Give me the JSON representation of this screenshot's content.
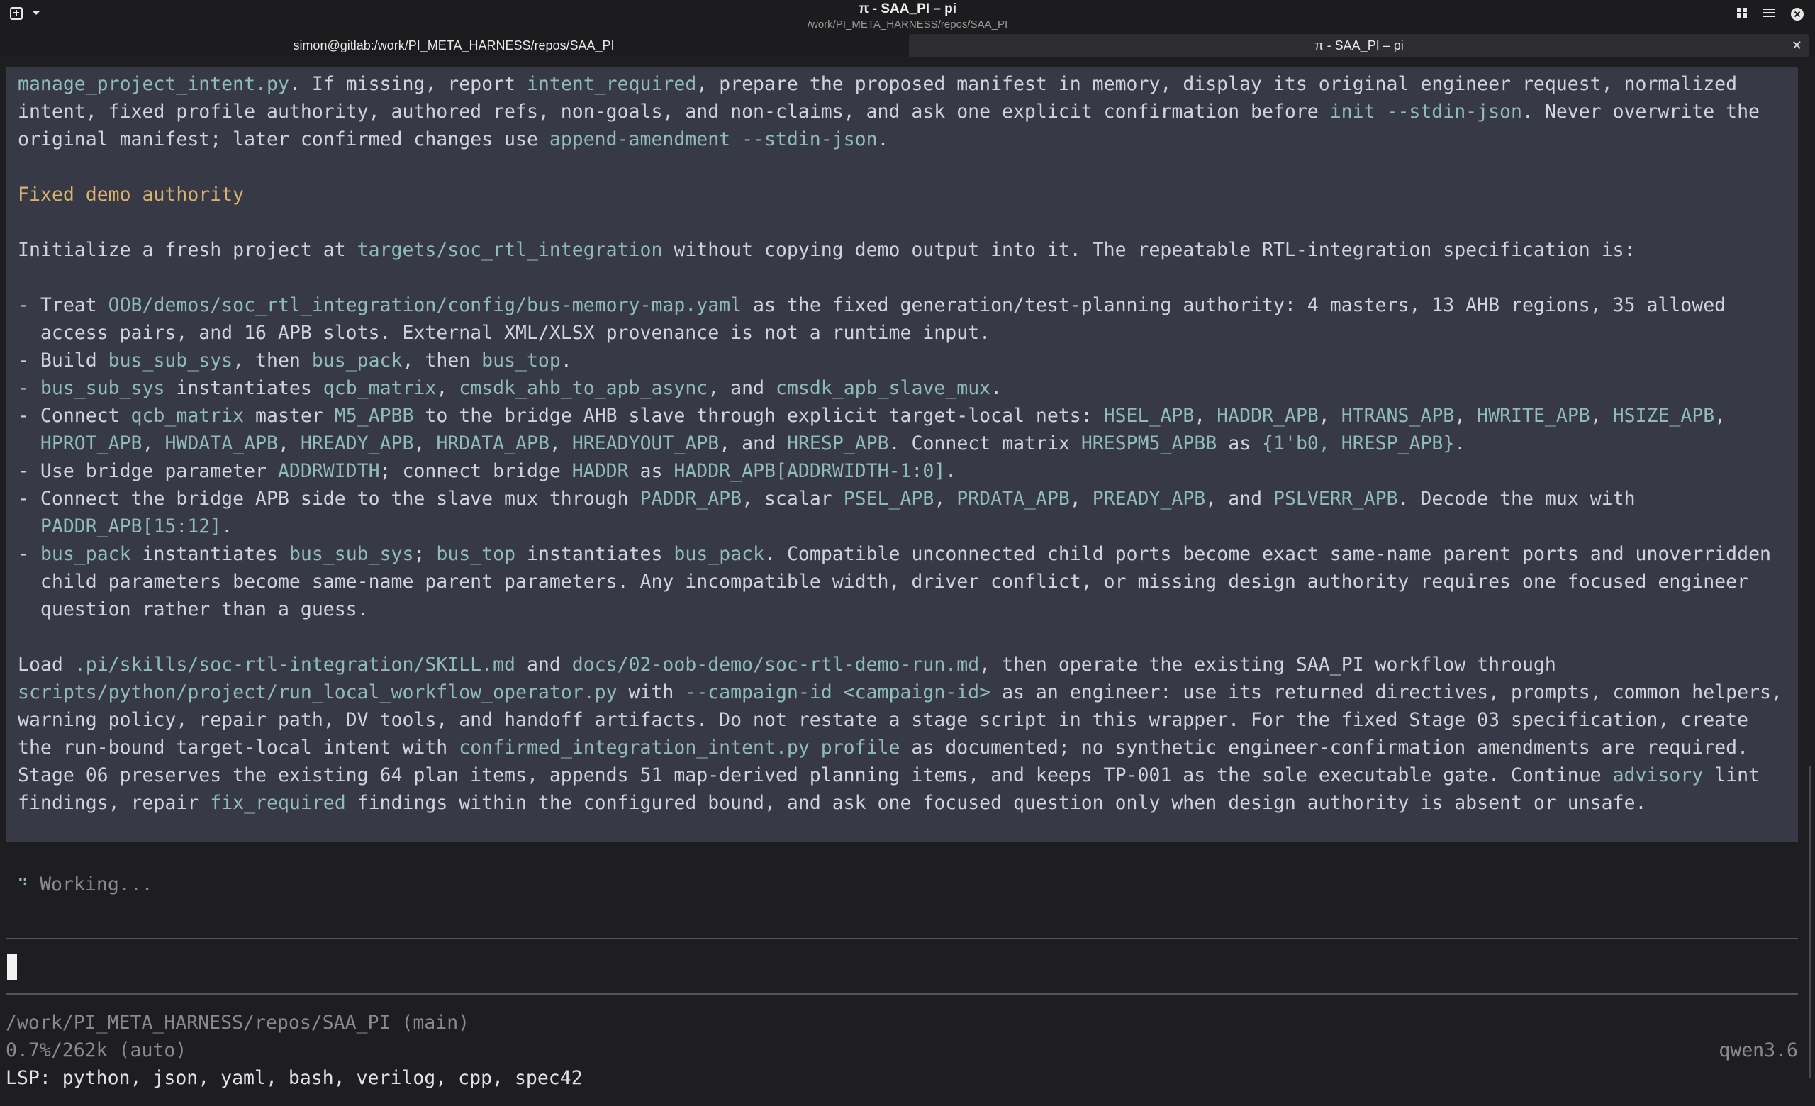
{
  "window": {
    "title": "π - SAA_PI – pi",
    "subtitle": "/work/PI_META_HARNESS/repos/SAA_PI",
    "icons": [
      "window-menu-icon",
      "dropdown-icon",
      "grid-icon",
      "hamburger-menu-icon",
      "close-icon"
    ]
  },
  "tabs": [
    {
      "label": "simon@gitlab:/work/PI_META_HARNESS/repos/SAA_PI",
      "active": false
    },
    {
      "label": "π - SAA_PI – pi",
      "active": true
    }
  ],
  "message": {
    "lines": [
      [
        {
          "t": "manage_project_intent.py",
          "s": "c"
        },
        {
          "t": ". If missing, report "
        },
        {
          "t": "intent_required",
          "s": "c"
        },
        {
          "t": ", prepare the proposed manifest in memory, display its original engineer request, normalized"
        }
      ],
      [
        {
          "t": "intent, fixed profile authority, authored refs, non-goals, and non-claims, and ask one explicit confirmation before "
        },
        {
          "t": "init --stdin-json",
          "s": "c"
        },
        {
          "t": ". Never overwrite the"
        }
      ],
      [
        {
          "t": "original manifest; later confirmed changes use "
        },
        {
          "t": "append-amendment --stdin-json",
          "s": "c"
        },
        {
          "t": "."
        }
      ],
      [],
      [
        {
          "t": "Fixed demo authority",
          "s": "h"
        }
      ],
      [],
      [
        {
          "t": "Initialize a fresh project at "
        },
        {
          "t": "targets/soc_rtl_integration",
          "s": "c"
        },
        {
          "t": " without copying demo output into it. The repeatable RTL-integration specification is:"
        }
      ],
      [],
      [
        {
          "t": "- Treat "
        },
        {
          "t": "OOB/demos/soc_rtl_integration/config/bus-memory-map.yaml",
          "s": "c"
        },
        {
          "t": " as the fixed generation/test-planning authority: 4 masters, 13 AHB regions, 35 allowed"
        }
      ],
      [
        {
          "t": "  access pairs, and 16 APB slots. External XML/XLSX provenance is not a runtime input."
        }
      ],
      [
        {
          "t": "- Build "
        },
        {
          "t": "bus_sub_sys",
          "s": "c"
        },
        {
          "t": ", then "
        },
        {
          "t": "bus_pack",
          "s": "c"
        },
        {
          "t": ", then "
        },
        {
          "t": "bus_top",
          "s": "c"
        },
        {
          "t": "."
        }
      ],
      [
        {
          "t": "- "
        },
        {
          "t": "bus_sub_sys",
          "s": "c"
        },
        {
          "t": " instantiates "
        },
        {
          "t": "qcb_matrix",
          "s": "c"
        },
        {
          "t": ", "
        },
        {
          "t": "cmsdk_ahb_to_apb_async",
          "s": "c"
        },
        {
          "t": ", and "
        },
        {
          "t": "cmsdk_apb_slave_mux",
          "s": "c"
        },
        {
          "t": "."
        }
      ],
      [
        {
          "t": "- Connect "
        },
        {
          "t": "qcb_matrix",
          "s": "c"
        },
        {
          "t": " master "
        },
        {
          "t": "M5_APBB",
          "s": "c"
        },
        {
          "t": " to the bridge AHB slave through explicit target-local nets: "
        },
        {
          "t": "HSEL_APB",
          "s": "c"
        },
        {
          "t": ", "
        },
        {
          "t": "HADDR_APB",
          "s": "c"
        },
        {
          "t": ", "
        },
        {
          "t": "HTRANS_APB",
          "s": "c"
        },
        {
          "t": ", "
        },
        {
          "t": "HWRITE_APB",
          "s": "c"
        },
        {
          "t": ", "
        },
        {
          "t": "HSIZE_APB",
          "s": "c"
        },
        {
          "t": ","
        }
      ],
      [
        {
          "t": "  "
        },
        {
          "t": "HPROT_APB",
          "s": "c"
        },
        {
          "t": ", "
        },
        {
          "t": "HWDATA_APB",
          "s": "c"
        },
        {
          "t": ", "
        },
        {
          "t": "HREADY_APB",
          "s": "c"
        },
        {
          "t": ", "
        },
        {
          "t": "HRDATA_APB",
          "s": "c"
        },
        {
          "t": ", "
        },
        {
          "t": "HREADYOUT_APB",
          "s": "c"
        },
        {
          "t": ", and "
        },
        {
          "t": "HRESP_APB",
          "s": "c"
        },
        {
          "t": ". Connect matrix "
        },
        {
          "t": "HRESPM5_APBB",
          "s": "c"
        },
        {
          "t": " as "
        },
        {
          "t": "{1'b0, HRESP_APB}",
          "s": "c"
        },
        {
          "t": "."
        }
      ],
      [
        {
          "t": "- Use bridge parameter "
        },
        {
          "t": "ADDRWIDTH",
          "s": "c"
        },
        {
          "t": "; connect bridge "
        },
        {
          "t": "HADDR",
          "s": "c"
        },
        {
          "t": " as "
        },
        {
          "t": "HADDR_APB[ADDRWIDTH-1:0]",
          "s": "c"
        },
        {
          "t": "."
        }
      ],
      [
        {
          "t": "- Connect the bridge APB side to the slave mux through "
        },
        {
          "t": "PADDR_APB",
          "s": "c"
        },
        {
          "t": ", scalar "
        },
        {
          "t": "PSEL_APB",
          "s": "c"
        },
        {
          "t": ", "
        },
        {
          "t": "PRDATA_APB",
          "s": "c"
        },
        {
          "t": ", "
        },
        {
          "t": "PREADY_APB",
          "s": "c"
        },
        {
          "t": ", and "
        },
        {
          "t": "PSLVERR_APB",
          "s": "c"
        },
        {
          "t": ". Decode the mux with"
        }
      ],
      [
        {
          "t": "  "
        },
        {
          "t": "PADDR_APB[15:12]",
          "s": "c"
        },
        {
          "t": "."
        }
      ],
      [
        {
          "t": "- "
        },
        {
          "t": "bus_pack",
          "s": "c"
        },
        {
          "t": " instantiates "
        },
        {
          "t": "bus_sub_sys",
          "s": "c"
        },
        {
          "t": "; "
        },
        {
          "t": "bus_top",
          "s": "c"
        },
        {
          "t": " instantiates "
        },
        {
          "t": "bus_pack",
          "s": "c"
        },
        {
          "t": ". Compatible unconnected child ports become exact same-name parent ports and unoverridden"
        }
      ],
      [
        {
          "t": "  child parameters become same-name parent parameters. Any incompatible width, driver conflict, or missing design authority requires one focused engineer"
        }
      ],
      [
        {
          "t": "  question rather than a guess."
        }
      ],
      [],
      [
        {
          "t": "Load "
        },
        {
          "t": ".pi/skills/soc-rtl-integration/SKILL.md",
          "s": "c"
        },
        {
          "t": " and "
        },
        {
          "t": "docs/02-oob-demo/soc-rtl-demo-run.md",
          "s": "c"
        },
        {
          "t": ", then operate the existing SAA_PI workflow through"
        }
      ],
      [
        {
          "t": "scripts/python/project/run_local_workflow_operator.py",
          "s": "c"
        },
        {
          "t": " with "
        },
        {
          "t": "--campaign-id <campaign-id>",
          "s": "c"
        },
        {
          "t": " as an engineer: use its returned directives, prompts, common helpers,"
        }
      ],
      [
        {
          "t": "warning policy, repair path, DV tools, and handoff artifacts. Do not restate a stage script in this wrapper. For the fixed Stage 03 specification, create"
        }
      ],
      [
        {
          "t": "the run-bound target-local intent with "
        },
        {
          "t": "confirmed_integration_intent.py profile",
          "s": "c"
        },
        {
          "t": " as documented; no synthetic engineer-confirmation amendments are required."
        }
      ],
      [
        {
          "t": "Stage 06 preserves the existing 64 plan items, appends 51 map-derived planning items, and keeps TP-001 as the sole executable gate. Continue "
        },
        {
          "t": "advisory",
          "s": "c"
        },
        {
          "t": " lint"
        }
      ],
      [
        {
          "t": "findings, repair "
        },
        {
          "t": "fix_required",
          "s": "c"
        },
        {
          "t": " findings within the configured bound, and ask one focused question only when design authority is absent or unsafe."
        }
      ]
    ]
  },
  "status": {
    "spinner": "⠙",
    "working": "Working..."
  },
  "footer": {
    "cwd": "/work/PI_META_HARNESS/repos/SAA_PI (main)",
    "context": "0.7%/262k (auto)",
    "model": "qwen3.6",
    "lsp": "LSP: python, json, yaml, bash, verilog, cpp, spec42"
  },
  "colors": {
    "background": "#1e1e20",
    "message_bg": "#373946",
    "code": "#8fbcbb",
    "heading": "#d9b36c",
    "text": "#d2d3d8",
    "muted": "#8a8a8e"
  }
}
